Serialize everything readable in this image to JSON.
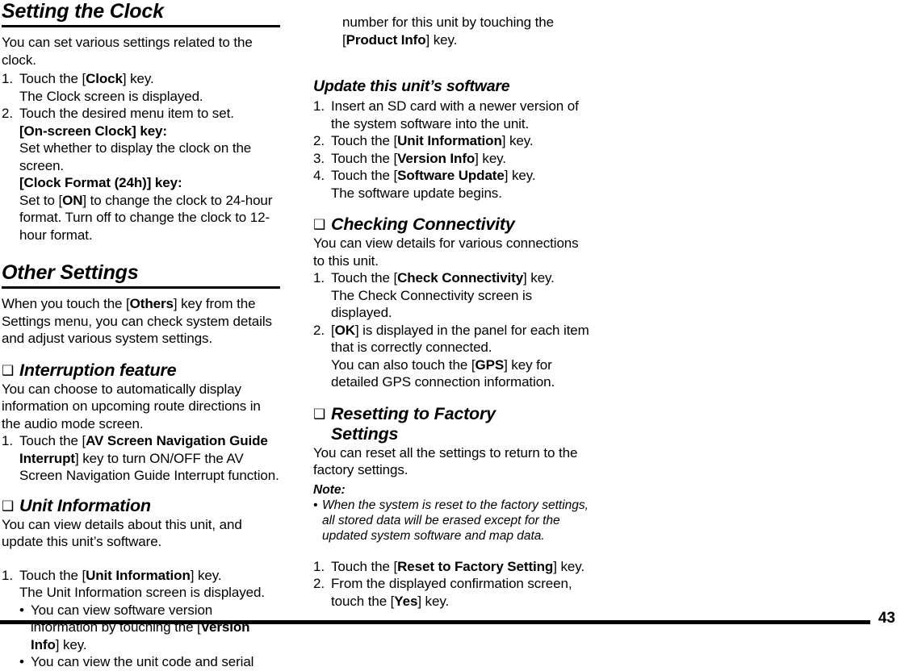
{
  "page": {
    "number": "43",
    "square_bullet_glyph": "❑",
    "round_bullet_glyph": "•"
  },
  "left_column": {
    "heading": "Setting the Clock",
    "intro": "You can set various settings related to the clock.",
    "steps": [
      {
        "number": "1.",
        "lines": [
          {
            "parts": [
              {
                "t": "Touch the [",
                "b": false
              },
              {
                "t": "Clock",
                "b": true
              },
              {
                "t": "] key.",
                "b": false
              }
            ]
          },
          {
            "parts": [
              {
                "t": "The Clock screen is displayed.",
                "b": false
              }
            ]
          }
        ]
      },
      {
        "number": "2.",
        "lines": [
          {
            "parts": [
              {
                "t": "Touch the desired menu item to set.",
                "b": false
              }
            ]
          },
          {
            "parts": [
              {
                "t": "[On-screen Clock] key:",
                "b": true
              }
            ]
          },
          {
            "parts": [
              {
                "t": "Set whether to display the clock on the screen.",
                "b": false
              }
            ]
          },
          {
            "parts": [
              {
                "t": "[Clock Format (24h)] key:",
                "b": true
              }
            ]
          },
          {
            "parts": [
              {
                "t": "Set to [",
                "b": false
              },
              {
                "t": "ON",
                "b": true
              },
              {
                "t": "] to change the clock to 24-hour format. Turn off to change the clock to 12-hour format.",
                "b": false
              }
            ]
          }
        ]
      }
    ],
    "heading2": "Other Settings",
    "intro2_parts": [
      {
        "t": "When you touch the [",
        "b": false
      },
      {
        "t": "Others",
        "b": true
      },
      {
        "t": "] key from the Settings menu, you can check system details and adjust various system settings.",
        "b": false
      }
    ],
    "section_interruption": {
      "title": "Interruption feature",
      "intro": "You can choose to automatically display information on upcoming route directions in the audio mode screen.",
      "steps": [
        {
          "number": "1.",
          "parts": [
            {
              "t": "Touch the [",
              "b": false
            },
            {
              "t": "AV Screen Navigation Guide Interrupt",
              "b": true
            },
            {
              "t": "] key to turn ON/OFF the AV Screen Navigation Guide Interrupt function.",
              "b": false
            }
          ]
        }
      ]
    },
    "section_unit_info": {
      "title": "Unit Information",
      "intro": "You can view details about this unit, and update this unit’s software.",
      "steps": [
        {
          "number": "1.",
          "lines": [
            {
              "parts": [
                {
                  "t": "Touch the [",
                  "b": false
                },
                {
                  "t": "Unit Information",
                  "b": true
                },
                {
                  "t": "] key.",
                  "b": false
                }
              ]
            },
            {
              "parts": [
                {
                  "t": "The Unit Information screen is displayed.",
                  "b": false
                }
              ]
            }
          ],
          "sub_bullets": [
            {
              "parts": [
                {
                  "t": "You can view software version information by touching the [",
                  "b": false
                },
                {
                  "t": "Version Info",
                  "b": true
                },
                {
                  "t": "] key.",
                  "b": false
                }
              ]
            },
            {
              "parts": [
                {
                  "t": "You can view the unit code and serial",
                  "b": false
                }
              ]
            }
          ]
        }
      ]
    }
  },
  "right_column": {
    "continued_bullet": {
      "parts": [
        {
          "t": "number for this unit by touching the [",
          "b": false
        },
        {
          "t": "Product Info",
          "b": true
        },
        {
          "t": "] key.",
          "b": false
        }
      ]
    },
    "section_update": {
      "title": "Update this unit’s software",
      "steps": [
        {
          "number": "1.",
          "parts": [
            {
              "t": "Insert an SD card with a newer version of the system software into the unit.",
              "b": false
            }
          ]
        },
        {
          "number": "2.",
          "parts": [
            {
              "t": "Touch the [",
              "b": false
            },
            {
              "t": "Unit Information",
              "b": true
            },
            {
              "t": "] key.",
              "b": false
            }
          ]
        },
        {
          "number": "3.",
          "parts": [
            {
              "t": "Touch the [",
              "b": false
            },
            {
              "t": "Version Info",
              "b": true
            },
            {
              "t": "] key.",
              "b": false
            }
          ]
        },
        {
          "number": "4.",
          "lines": [
            {
              "parts": [
                {
                  "t": "Touch the [",
                  "b": false
                },
                {
                  "t": "Software Update",
                  "b": true
                },
                {
                  "t": "] key.",
                  "b": false
                }
              ]
            },
            {
              "parts": [
                {
                  "t": "The software update begins.",
                  "b": false
                }
              ]
            }
          ]
        }
      ]
    },
    "section_connectivity": {
      "title": "Checking Connectivity",
      "intro": "You can view details for various connections to this unit.",
      "steps": [
        {
          "number": "1.",
          "lines": [
            {
              "parts": [
                {
                  "t": "Touch the [",
                  "b": false
                },
                {
                  "t": "Check Connectivity",
                  "b": true
                },
                {
                  "t": "] key.",
                  "b": false
                }
              ]
            },
            {
              "parts": [
                {
                  "t": "The Check Connectivity screen is displayed.",
                  "b": false
                }
              ]
            }
          ]
        },
        {
          "number": "2.",
          "lines": [
            {
              "parts": [
                {
                  "t": "[",
                  "b": false
                },
                {
                  "t": "OK",
                  "b": true
                },
                {
                  "t": "] is displayed in the panel for each item that is correctly connected.",
                  "b": false
                }
              ]
            },
            {
              "parts": [
                {
                  "t": "You can also touch the [",
                  "b": false
                },
                {
                  "t": "GPS",
                  "b": true
                },
                {
                  "t": "] key for detailed GPS connection information.",
                  "b": false
                }
              ]
            }
          ]
        }
      ]
    },
    "section_reset": {
      "title_line1": "Resetting to Factory",
      "title_line2": "Settings",
      "intro": "You can reset all the settings to return to the factory settings.",
      "note_label": "Note:",
      "note_items": [
        "When the system is reset to the factory settings, all stored data will be erased except for the updated system software and map data."
      ],
      "steps": [
        {
          "number": "1.",
          "parts": [
            {
              "t": "Touch the [",
              "b": false
            },
            {
              "t": "Reset to Factory Setting",
              "b": true
            },
            {
              "t": "] key.",
              "b": false
            }
          ]
        },
        {
          "number": "2.",
          "parts": [
            {
              "t": "From the displayed confirmation screen, touch the [",
              "b": false
            },
            {
              "t": "Yes",
              "b": true
            },
            {
              "t": "] key.",
              "b": false
            }
          ]
        }
      ]
    }
  }
}
